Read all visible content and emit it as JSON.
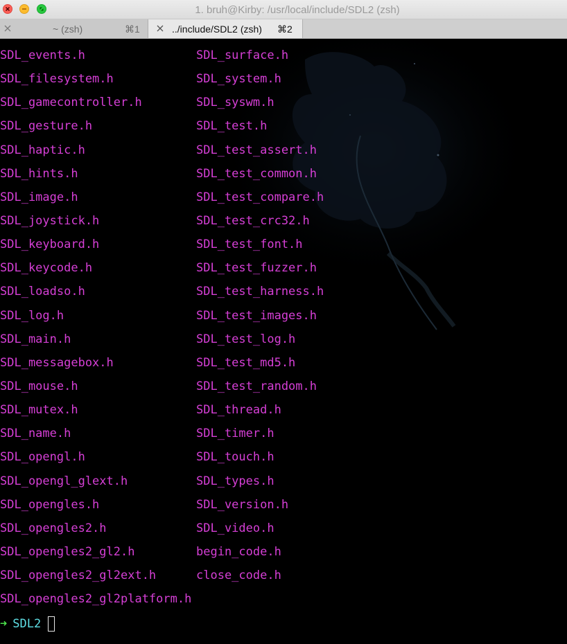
{
  "window": {
    "title": "1. bruh@Kirby: /usr/local/include/SDL2 (zsh)",
    "buttons": [
      "close",
      "minimize",
      "fullscreen"
    ]
  },
  "tabs": [
    {
      "label": "~ (zsh)",
      "shortcut": "⌘1",
      "active": false
    },
    {
      "label": "../include/SDL2 (zsh)",
      "shortcut": "⌘2",
      "active": true
    }
  ],
  "colors": {
    "file": "#d63fd6",
    "prompt_arrow": "#4de24d",
    "prompt_dir": "#5fe0e6",
    "background": "#000000"
  },
  "listing": {
    "col1": [
      "SDL_events.h",
      "SDL_filesystem.h",
      "SDL_gamecontroller.h",
      "SDL_gesture.h",
      "SDL_haptic.h",
      "SDL_hints.h",
      "SDL_image.h",
      "SDL_joystick.h",
      "SDL_keyboard.h",
      "SDL_keycode.h",
      "SDL_loadso.h",
      "SDL_log.h",
      "SDL_main.h",
      "SDL_messagebox.h",
      "SDL_mouse.h",
      "SDL_mutex.h",
      "SDL_name.h",
      "SDL_opengl.h",
      "SDL_opengl_glext.h",
      "SDL_opengles.h",
      "SDL_opengles2.h",
      "SDL_opengles2_gl2.h",
      "SDL_opengles2_gl2ext.h",
      "SDL_opengles2_gl2platform.h"
    ],
    "col2": [
      "SDL_surface.h",
      "SDL_system.h",
      "SDL_syswm.h",
      "SDL_test.h",
      "SDL_test_assert.h",
      "SDL_test_common.h",
      "SDL_test_compare.h",
      "SDL_test_crc32.h",
      "SDL_test_font.h",
      "SDL_test_fuzzer.h",
      "SDL_test_harness.h",
      "SDL_test_images.h",
      "SDL_test_log.h",
      "SDL_test_md5.h",
      "SDL_test_random.h",
      "SDL_thread.h",
      "SDL_timer.h",
      "SDL_touch.h",
      "SDL_types.h",
      "SDL_version.h",
      "SDL_video.h",
      "begin_code.h",
      "close_code.h"
    ]
  },
  "prompt": {
    "arrow": "➜",
    "directory": "SDL2"
  }
}
